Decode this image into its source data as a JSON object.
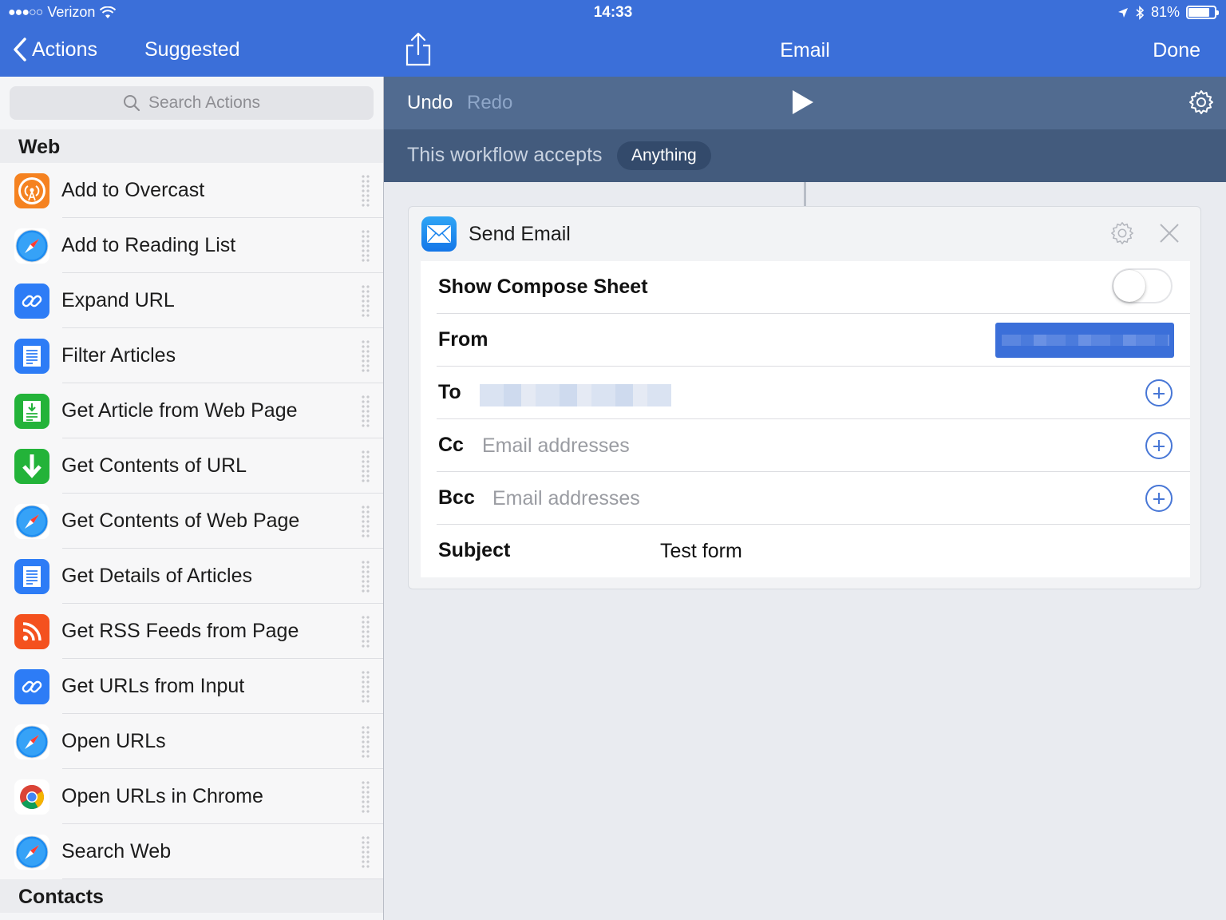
{
  "status_bar": {
    "carrier": "Verizon",
    "signal_dots": "●●●○○",
    "time": "14:33",
    "battery": "81%",
    "battery_level": 0.81
  },
  "left_nav": {
    "back_label": "Actions",
    "title": "Suggested"
  },
  "right_nav": {
    "title": "Email",
    "done_label": "Done"
  },
  "search": {
    "placeholder": "Search Actions"
  },
  "sections": {
    "web": "Web",
    "contacts": "Contacts"
  },
  "actions": [
    {
      "label": "Add to Overcast",
      "icon": "overcast-icon"
    },
    {
      "label": "Add to Reading List",
      "icon": "safari-icon"
    },
    {
      "label": "Expand URL",
      "icon": "link-icon"
    },
    {
      "label": "Filter Articles",
      "icon": "article-icon"
    },
    {
      "label": "Get Article from Web Page",
      "icon": "article-green-icon"
    },
    {
      "label": "Get Contents of URL",
      "icon": "download-arrow-icon"
    },
    {
      "label": "Get Contents of Web Page",
      "icon": "safari-icon"
    },
    {
      "label": "Get Details of Articles",
      "icon": "article-icon"
    },
    {
      "label": "Get RSS Feeds from Page",
      "icon": "rss-icon"
    },
    {
      "label": "Get URLs from Input",
      "icon": "link-icon"
    },
    {
      "label": "Open URLs",
      "icon": "safari-icon"
    },
    {
      "label": "Open URLs in Chrome",
      "icon": "chrome-icon"
    },
    {
      "label": "Search Web",
      "icon": "safari-icon"
    }
  ],
  "toolbar": {
    "undo_label": "Undo",
    "redo_label": "Redo"
  },
  "accepts": {
    "text": "This workflow accepts",
    "value": "Anything"
  },
  "card": {
    "title": "Send Email",
    "show_compose_label": "Show Compose Sheet",
    "show_compose_on": false,
    "from_label": "From",
    "to_label": "To",
    "cc_label": "Cc",
    "cc_placeholder": "Email addresses",
    "bcc_label": "Bcc",
    "bcc_placeholder": "Email addresses",
    "subject_label": "Subject",
    "subject_value": "Test form"
  },
  "colors": {
    "accent": "#3b6fd9",
    "toolbar": "#516b90",
    "accepts_bar": "#435b7d"
  }
}
